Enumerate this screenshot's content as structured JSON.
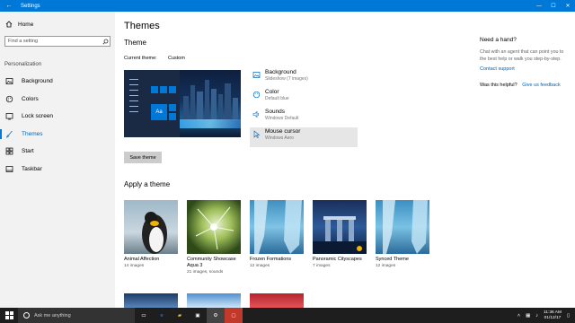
{
  "window": {
    "title": "Settings",
    "controls": {
      "minimize": "—",
      "maximize": "☐",
      "close": "✕"
    }
  },
  "sidebar": {
    "home_label": "Home",
    "search_placeholder": "Find a setting",
    "section_label": "Personalization",
    "items": [
      {
        "label": "Background",
        "icon": "image-icon",
        "active": false
      },
      {
        "label": "Colors",
        "icon": "palette-icon",
        "active": false
      },
      {
        "label": "Lock screen",
        "icon": "lock-screen-icon",
        "active": false
      },
      {
        "label": "Themes",
        "icon": "brush-icon",
        "active": true
      },
      {
        "label": "Start",
        "icon": "start-icon",
        "active": false
      },
      {
        "label": "Taskbar",
        "icon": "taskbar-icon",
        "active": false
      }
    ]
  },
  "main": {
    "page_title": "Themes",
    "section_title": "Theme",
    "current_theme_label": "Current theme:",
    "current_theme_value": "Custom",
    "settings": [
      {
        "title": "Background",
        "subtitle": "Slideshow (7 images)",
        "icon": "image-icon"
      },
      {
        "title": "Color",
        "subtitle": "Default blue",
        "icon": "palette-icon"
      },
      {
        "title": "Sounds",
        "subtitle": "Windows Default",
        "icon": "speaker-icon"
      },
      {
        "title": "Mouse cursor",
        "subtitle": "Windows Aero",
        "icon": "cursor-icon"
      }
    ],
    "save_button": "Save theme",
    "preview_tile_text": "Aa",
    "apply_title": "Apply a theme",
    "themes": [
      {
        "name": "Animal Affection",
        "sub": "14 images"
      },
      {
        "name": "Community Showcase Aqua 3",
        "sub": "21 images, sounds"
      },
      {
        "name": "Frozen Formations",
        "sub": "12 images"
      },
      {
        "name": "Panoramic Cityscapes",
        "sub": "7 images"
      },
      {
        "name": "Synced Theme",
        "sub": "12 images"
      }
    ]
  },
  "help": {
    "title": "Need a hand?",
    "text": "Chat with an agent that can point you to the best help or walk you step-by-step.",
    "link": "Contact support",
    "question": "Was this helpful?",
    "question_link": "Give us feedback"
  },
  "taskbar": {
    "search_placeholder": "Ask me anything",
    "time": "11:36 AM",
    "date": "01/12/17"
  }
}
